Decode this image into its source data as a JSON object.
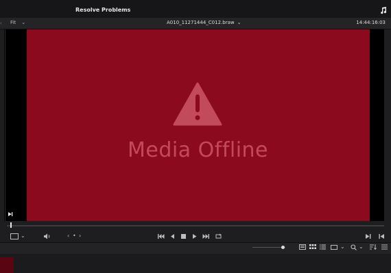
{
  "window": {
    "title": "Resolve Problems"
  },
  "viewer_header": {
    "fit_label": "Fit",
    "filename": "A010_11271444_C012.braw",
    "timecode": "14:44:16:03"
  },
  "viewer": {
    "offline_message": "Media Offline"
  },
  "colors": {
    "background": "#1e1e21",
    "offline_red": "#8c0a1e",
    "offline_text": "#c24a5b"
  },
  "icons": {
    "top_right": "music-note-icon",
    "transport": [
      "first-frame-icon",
      "step-back-icon",
      "stop-icon",
      "play-icon",
      "last-frame-icon",
      "loop-icon"
    ]
  }
}
